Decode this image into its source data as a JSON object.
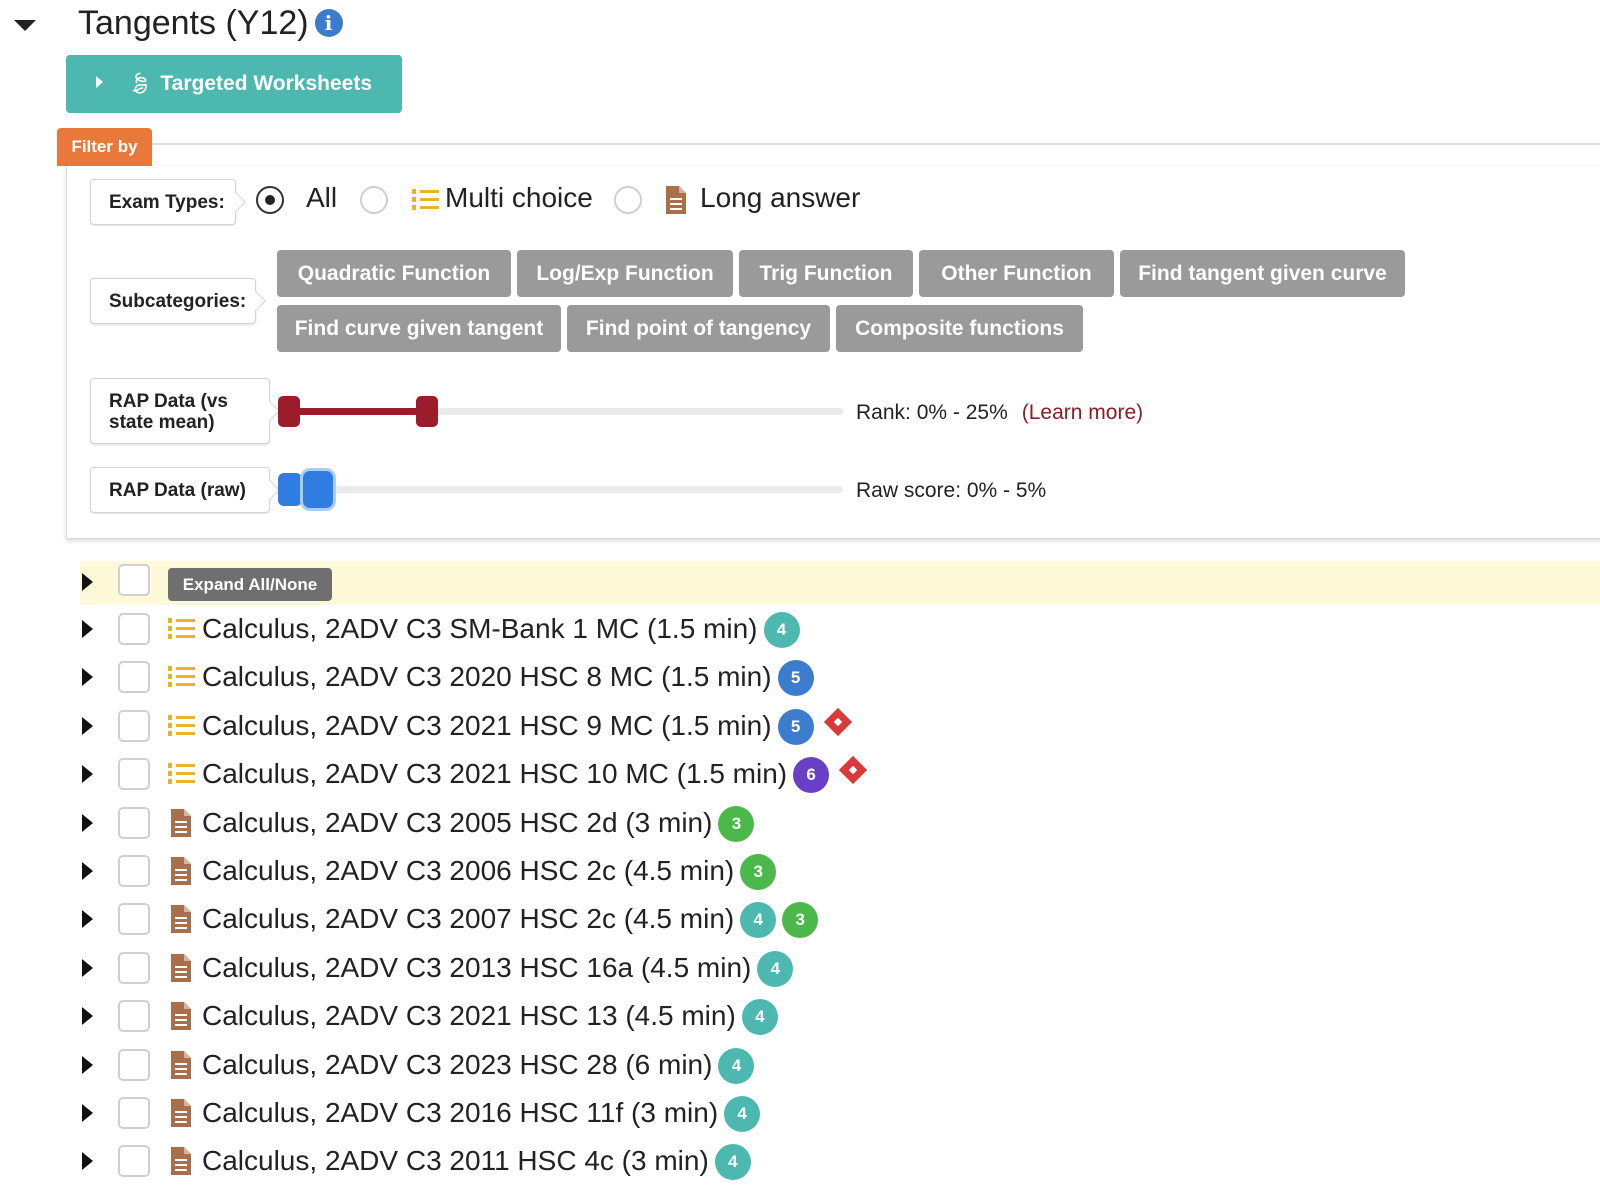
{
  "header": {
    "title": "Tangents (Y12)",
    "info_icon": "i"
  },
  "worksheets_button": {
    "label": "Targeted Worksheets",
    "icon": "leaf-icon"
  },
  "filter": {
    "tag": "Filter by",
    "exam_types": {
      "label": "Exam Types:",
      "options": [
        {
          "label": "All",
          "selected": true
        },
        {
          "label": "Multi choice",
          "selected": false,
          "icon": "multichoice-list-icon"
        },
        {
          "label": "Long answer",
          "selected": false,
          "icon": "document-icon"
        }
      ]
    },
    "subcategories": {
      "label": "Subcategories:",
      "chips": [
        "Quadratic Function",
        "Log/Exp Function",
        "Trig Function",
        "Other Function",
        "Find tangent given curve",
        "Find curve given tangent",
        "Find point of tangency",
        "Composite functions"
      ]
    },
    "rap_mean": {
      "label": "RAP Data (vs state mean)",
      "text": "Rank: 0% - 25%",
      "learn_more": "(Learn more)",
      "range_pct": [
        0,
        25
      ],
      "color": "#9b1c2b"
    },
    "rap_raw": {
      "label": "RAP Data (raw)",
      "text": "Raw score: 0% - 5%",
      "range_pct": [
        0,
        5
      ],
      "color": "#2f7de1"
    }
  },
  "list": {
    "expand_label": "Expand All/None",
    "colors": {
      "4": "#4db8b0",
      "5": "#3b7ccc",
      "6": "#6a3fc8",
      "3": "#4cb84c",
      "flag": "#d83a3a"
    },
    "items": [
      {
        "text": "Calculus, 2ADV C3 SM-Bank 1 MC (1.5 min)",
        "type": "mc",
        "badges": [
          "4"
        ],
        "flag": false
      },
      {
        "text": "Calculus, 2ADV C3 2020 HSC 8 MC (1.5 min)",
        "type": "mc",
        "badges": [
          "5"
        ],
        "flag": false
      },
      {
        "text": "Calculus, 2ADV C3 2021 HSC 9 MC (1.5 min)",
        "type": "mc",
        "badges": [
          "5"
        ],
        "flag": true
      },
      {
        "text": "Calculus, 2ADV C3 2021 HSC 10 MC (1.5 min)",
        "type": "mc",
        "badges": [
          "6"
        ],
        "flag": true
      },
      {
        "text": "Calculus, 2ADV C3 2005 HSC 2d (3 min)",
        "type": "la",
        "badges": [
          "3"
        ],
        "flag": false
      },
      {
        "text": "Calculus, 2ADV C3 2006 HSC 2c (4.5 min)",
        "type": "la",
        "badges": [
          "3"
        ],
        "flag": false
      },
      {
        "text": "Calculus, 2ADV C3 2007 HSC 2c (4.5 min)",
        "type": "la",
        "badges": [
          "4",
          "3"
        ],
        "flag": false
      },
      {
        "text": "Calculus, 2ADV C3 2013 HSC 16a (4.5 min)",
        "type": "la",
        "badges": [
          "4"
        ],
        "flag": false
      },
      {
        "text": "Calculus, 2ADV C3 2021 HSC 13 (4.5 min)",
        "type": "la",
        "badges": [
          "4"
        ],
        "flag": false
      },
      {
        "text": "Calculus, 2ADV C3 2023 HSC 28 (6 min)",
        "type": "la",
        "badges": [
          "4"
        ],
        "flag": false
      },
      {
        "text": "Calculus, 2ADV C3 2016 HSC 11f (3 min)",
        "type": "la",
        "badges": [
          "4"
        ],
        "flag": false
      },
      {
        "text": "Calculus, 2ADV C3 2011 HSC 4c (3 min)",
        "type": "la",
        "badges": [
          "4"
        ],
        "flag": false
      }
    ]
  }
}
